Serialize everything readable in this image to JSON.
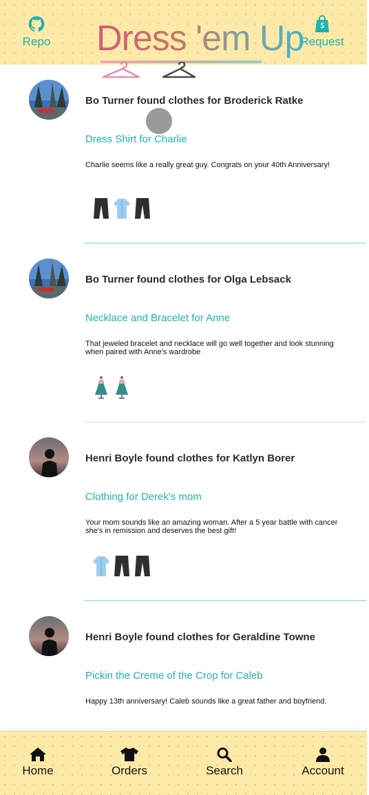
{
  "header": {
    "repo_label": "Repo",
    "request_label": "Request",
    "logo_text": "Dress 'em Up",
    "repo_icon": "github-icon",
    "request_icon": "shopping-bag-icon"
  },
  "colors": {
    "accent": "#1fb2ad",
    "header_bg": "#fdeaa8",
    "divider": "#7fd3d0"
  },
  "posts": [
    {
      "title": "Bo Turner found clothes for Broderick Ratke",
      "request_title": "Dress Shirt for Charlie",
      "body": "Charlie seems like a really great guy. Congrats on your 40th Anniversary!",
      "items": [
        "pants-icon",
        "shirt-icon",
        "pants-icon"
      ],
      "avatar": "landscape"
    },
    {
      "title": "Bo Turner found clothes for Olga Lebsack",
      "request_title": "Necklace and Bracelet for Anne",
      "body": "That jeweled bracelet and necklace will go well together and look stunning when paired with Anne's wardrobe",
      "items": [
        "dress-icon",
        "dress-icon"
      ],
      "avatar": "landscape"
    },
    {
      "title": "Henri Boyle found clothes for Katlyn Borer",
      "request_title": "Clothing for Derek's mom",
      "body": "Your mom sounds like an amazing woman. After a 5 year battle with cancer she's in remission and deserves the best gift!",
      "items": [
        "shirt-icon",
        "pants-icon",
        "pants-icon"
      ],
      "avatar": "silhouette"
    },
    {
      "title": "Henri Boyle found clothes for Geraldine Towne",
      "request_title": "Pickin the Creme of the Crop for Caleb",
      "body": "Happy 13th anniversary! Caleb sounds like a great father and boyfriend.",
      "items": [],
      "avatar": "silhouette"
    }
  ],
  "nav": {
    "home": "Home",
    "orders": "Orders",
    "search": "Search",
    "account": "Account"
  }
}
